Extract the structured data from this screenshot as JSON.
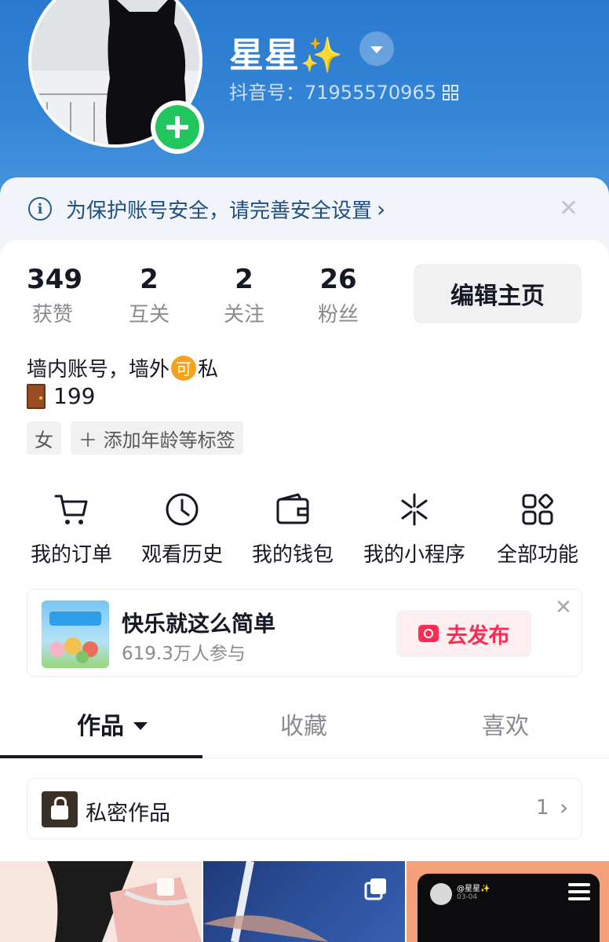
{
  "profile": {
    "name": "星星✨",
    "douyin_id": "抖音号：71955570965"
  },
  "security_banner": {
    "text": "为保护账号安全，请完善安全设置"
  },
  "stats": [
    {
      "value": "349",
      "label": "获赞"
    },
    {
      "value": "2",
      "label": "互关"
    },
    {
      "value": "2",
      "label": "关注"
    },
    {
      "value": "26",
      "label": "粉丝"
    }
  ],
  "edit_button": "编辑主页",
  "bio": {
    "line1_pre": "墙内账号，墙外",
    "line1_badge": "可",
    "line1_post": "私",
    "line2": "199"
  },
  "tags": {
    "gender": "女",
    "add_tags": "＋ 添加年龄等标签"
  },
  "functions": [
    {
      "label": "我的订单",
      "icon": "cart-icon"
    },
    {
      "label": "观看历史",
      "icon": "clock-icon"
    },
    {
      "label": "我的钱包",
      "icon": "wallet-icon"
    },
    {
      "label": "我的小程序",
      "icon": "mini-program-icon"
    },
    {
      "label": "全部功能",
      "icon": "grid-icon"
    }
  ],
  "promo": {
    "title": "快乐就这么简单",
    "subtitle": "619.3万人参与",
    "button": "去发布"
  },
  "tabs": [
    {
      "label": "作品",
      "active": true
    },
    {
      "label": "收藏",
      "active": false
    },
    {
      "label": "喜欢",
      "active": false
    }
  ],
  "private_works": {
    "label": "私密作品",
    "count": "1"
  },
  "thumbnail_3": {
    "name": "@星星✨",
    "date": "03-04"
  },
  "colors": {
    "header_blue": "#3384d6",
    "accent_red": "#fe2c55",
    "add_green": "#22c55e"
  }
}
